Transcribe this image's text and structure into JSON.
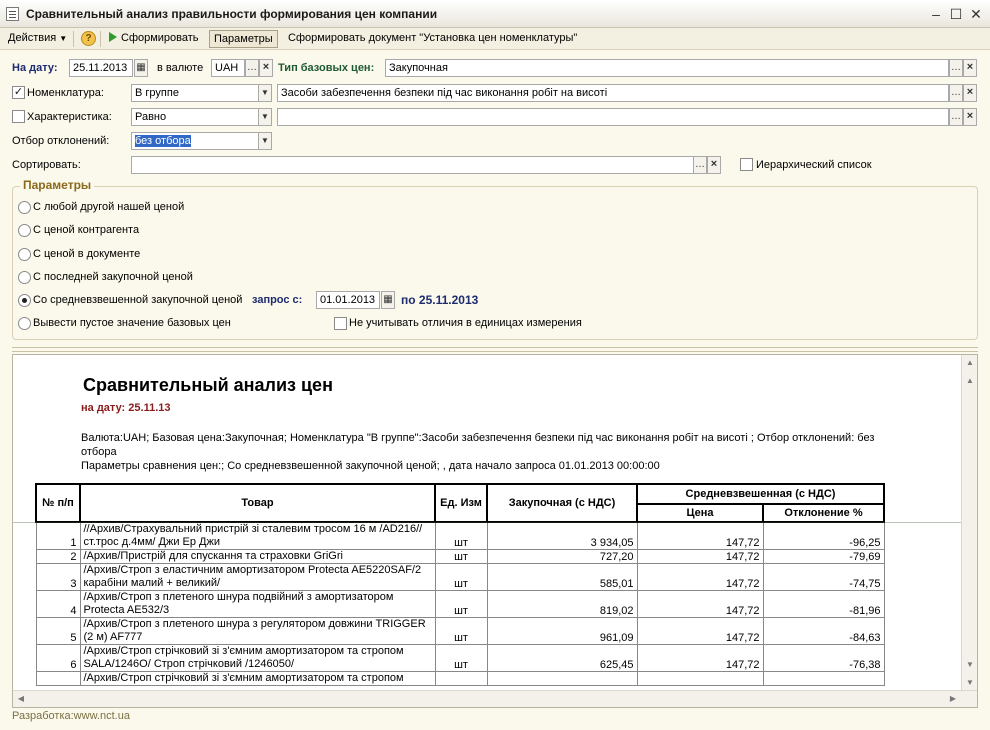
{
  "window": {
    "title": "Сравнительный анализ правильности формирования цен компании",
    "minimize": "–",
    "maximize": "☐",
    "close": "✕"
  },
  "toolbar": {
    "actions_label": "Действия",
    "help_label": "?",
    "form_label": "Сформировать",
    "params_label": "Параметры",
    "create_doc_label": "Сформировать документ \"Установка цен номенклатуры\""
  },
  "form": {
    "date_label": "На дату:",
    "date_value": "25.11.2013",
    "currency_label": "в валюте",
    "currency_value": "UAH",
    "base_price_type_label": "Тип базовых цен:",
    "base_price_type_value": "Закупочная",
    "nomenclature_label": "Номенклатура:",
    "nomenclature_mode": "В группе",
    "nomenclature_value": "Засоби забезпечення безпеки під час  виконання робіт на висоті",
    "characteristic_label": "Характеристика:",
    "characteristic_mode": "Равно",
    "characteristic_value": "",
    "deviation_filter_label": "Отбор отклонений:",
    "deviation_filter_value": "без отбора",
    "sort_label": "Сортировать:",
    "sort_value": "",
    "hierarchy_label": "Иерархический список",
    "nomenclature_checked": "✓"
  },
  "params": {
    "group_title": "Параметры",
    "options": [
      "С любой другой нашей ценой",
      "С ценой контрагента",
      "С ценой в документе",
      "С последней закупочной ценой",
      "Со средневзвешенной закупочной ценой",
      "Вывести пустое значение базовых цен"
    ],
    "request_from_label": "запрос с:",
    "request_from_value": "01.01.2013",
    "request_to_label": "по 25.11.2013",
    "ignore_units_label": "Не учитывать отличия в единицах измерения"
  },
  "report": {
    "title": "Сравнительный анализ цен",
    "date_line": "на дату: 25.11.13",
    "params_line1": "Валюта:UAH;  Базовая цена:Закупочная; Номенклатура \"В группе\":Засоби забезпечення безпеки під час  виконання робіт на висоті ;  Отбор отклонений: без отбора",
    "params_line2": "Параметры сравнения цен:;  Со средневзвешенной закупочной ценой; , дата начало запроса 01.01.2013 00:00:00",
    "columns": {
      "num": "№ п/п",
      "item": "Товар",
      "unit": "Ед. Изм",
      "purchase": "Закупочная (с НДС)",
      "weighted": "Средневзвешенная (с НДС)",
      "price": "Цена",
      "deviation": "Отклонение %"
    },
    "rows": [
      {
        "n": "1",
        "item": "//Архив/Страхувальний пристрій зі сталевим тросом 16 м /AD216//ст.трос д.4мм/ Джи Ер Джи",
        "unit": "шт",
        "purchase": "3 934,05",
        "price": "147,72",
        "dev": "-96,25"
      },
      {
        "n": "2",
        "item": "/Архив/Пристрій для спускання та страховки  GriGri",
        "unit": "шт",
        "purchase": "727,20",
        "price": "147,72",
        "dev": "-79,69"
      },
      {
        "n": "3",
        "item": "/Архив/Строп з еластичним амортизатором Protecta AE5220SAF/2 карабіни малий + великий/",
        "unit": "шт",
        "purchase": "585,01",
        "price": "147,72",
        "dev": "-74,75"
      },
      {
        "n": "4",
        "item": "/Архив/Строп з плетеного шнура  подвійний з амортизатором Protecta AE532/3",
        "unit": "шт",
        "purchase": "819,02",
        "price": "147,72",
        "dev": "-81,96"
      },
      {
        "n": "5",
        "item": "/Архив/Строп з плетеного шнура з регулятором довжини TRIGGER (2 м) AF777",
        "unit": "шт",
        "purchase": "961,09",
        "price": "147,72",
        "dev": "-84,63"
      },
      {
        "n": "6",
        "item": "/Архив/Строп стрічковий зі з'ємним амортизатором та стропом SALA/1246O/  Строп стрічковий /1246050/",
        "unit": "шт",
        "purchase": "625,45",
        "price": "147,72",
        "dev": "-76,38"
      },
      {
        "n": "",
        "item": "/Архив/Строп стрічковий зі з'ємним амортизатором та стропом",
        "unit": "",
        "purchase": "",
        "price": "",
        "dev": ""
      }
    ]
  },
  "footer": {
    "text": "Разработка:www.nct.ua"
  }
}
